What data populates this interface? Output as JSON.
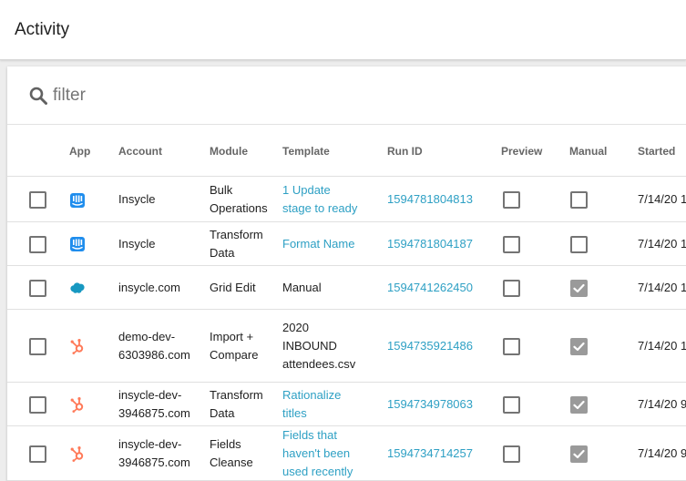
{
  "page": {
    "title": "Activity"
  },
  "filter": {
    "placeholder": "filter",
    "value": ""
  },
  "columns": {
    "app": "App",
    "account": "Account",
    "module": "Module",
    "template": "Template",
    "run_id": "Run ID",
    "preview": "Preview",
    "manual": "Manual",
    "started": "Started"
  },
  "colors": {
    "link": "#2ea0c4",
    "intercom": "#1f8ded",
    "salesforce": "#1798c1",
    "hubspot": "#ff7a59",
    "checked": "#9a9a9a"
  },
  "rows": [
    {
      "app_icon": "intercom-icon",
      "account": [
        "Insycle"
      ],
      "module": [
        "Bulk",
        "Operations"
      ],
      "template": [
        "1 Update",
        "stage to ready"
      ],
      "template_link": true,
      "run_id": "1594781804813",
      "preview": false,
      "manual": false,
      "started": "7/14/20 1"
    },
    {
      "app_icon": "intercom-icon",
      "account": [
        "Insycle"
      ],
      "module": [
        "Transform",
        "Data"
      ],
      "template": [
        "Format Name"
      ],
      "template_link": true,
      "run_id": "1594781804187",
      "preview": false,
      "manual": false,
      "started": "7/14/20 1"
    },
    {
      "app_icon": "salesforce-icon",
      "account": [
        "insycle.com"
      ],
      "module": [
        "Grid Edit"
      ],
      "template": [
        "Manual"
      ],
      "template_link": false,
      "run_id": "1594741262450",
      "preview": false,
      "manual": true,
      "started": "7/14/20 1"
    },
    {
      "app_icon": "hubspot-icon",
      "account": [
        "demo-dev-",
        "6303986.com"
      ],
      "module": [
        "Import +",
        "Compare"
      ],
      "template": [
        "2020",
        "INBOUND",
        "attendees.csv"
      ],
      "template_link": false,
      "run_id": "1594735921486",
      "preview": false,
      "manual": true,
      "started": "7/14/20 1"
    },
    {
      "app_icon": "hubspot-icon",
      "account": [
        "insycle-dev-",
        "3946875.com"
      ],
      "module": [
        "Transform",
        "Data"
      ],
      "template": [
        "Rationalize",
        "titles"
      ],
      "template_link": true,
      "run_id": "1594734978063",
      "preview": false,
      "manual": true,
      "started": "7/14/20 9"
    },
    {
      "app_icon": "hubspot-icon",
      "account": [
        "insycle-dev-",
        "3946875.com"
      ],
      "module": [
        "Fields",
        "Cleanse"
      ],
      "template": [
        "Fields that",
        "haven't been",
        "used recently"
      ],
      "template_link": true,
      "run_id": "1594734714257",
      "preview": false,
      "manual": true,
      "started": "7/14/20 9"
    }
  ]
}
